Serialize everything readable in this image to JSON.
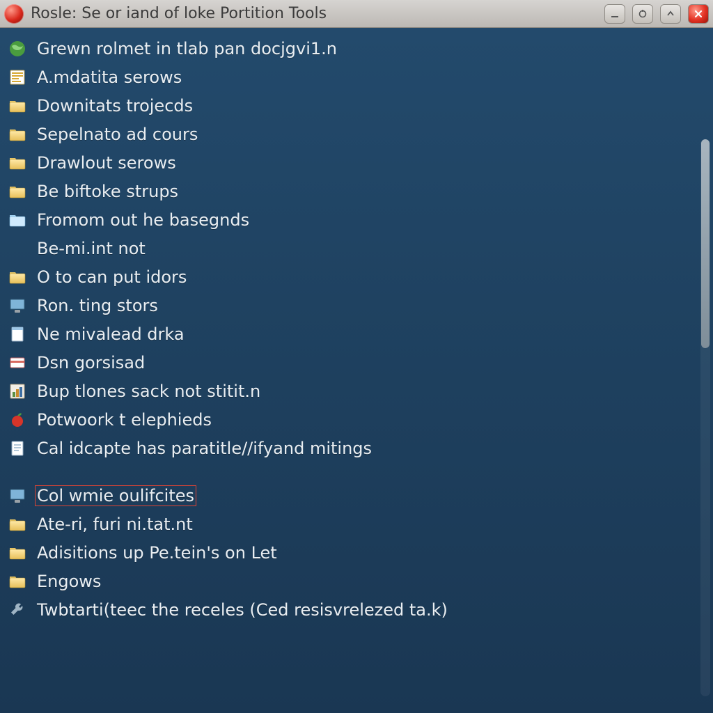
{
  "window": {
    "title": "Rosle: Se or iand of loke Portition Tools"
  },
  "items": [
    {
      "icon": "globe",
      "label": "Grewn rolmet in tlab pan docjgvi1.n"
    },
    {
      "icon": "list",
      "label": "A.mdatita serows"
    },
    {
      "icon": "folder",
      "label": "Downitats trojecds"
    },
    {
      "icon": "folder",
      "label": "Sepelnato ad cours"
    },
    {
      "icon": "folder",
      "label": "Drawlout serows"
    },
    {
      "icon": "folder",
      "label": "Be biftoke strups"
    },
    {
      "icon": "folder-blue",
      "label": "Fromom out he basegnds"
    },
    {
      "icon": "blank",
      "label": "Be-mi.int not"
    },
    {
      "icon": "folder",
      "label": "O to can put idors"
    },
    {
      "icon": "monitor",
      "label": "Ron. ting stors"
    },
    {
      "icon": "page",
      "label": "Ne mivalead drka"
    },
    {
      "icon": "card",
      "label": "Dsn gorsisad"
    },
    {
      "icon": "chart",
      "label": "Bup tlones sack not stitit.n"
    },
    {
      "icon": "apple",
      "label": "Potwoork t elephieds"
    },
    {
      "icon": "note",
      "label": "Cal idcapte has paratitle//ifyand mitings"
    },
    {
      "icon": "gap"
    },
    {
      "icon": "monitor",
      "label": "Col wmie oulifcites",
      "highlighted": true
    },
    {
      "icon": "folder",
      "label": "Ate-ri, furi ni.tat.nt"
    },
    {
      "icon": "folder",
      "label": "Adisitions up Pe.tein's on Let"
    },
    {
      "icon": "folder",
      "label": "Engows"
    },
    {
      "icon": "tool",
      "label": "Twbtarti(teec the receles (Ced resisvrelezed ta.k)"
    }
  ]
}
